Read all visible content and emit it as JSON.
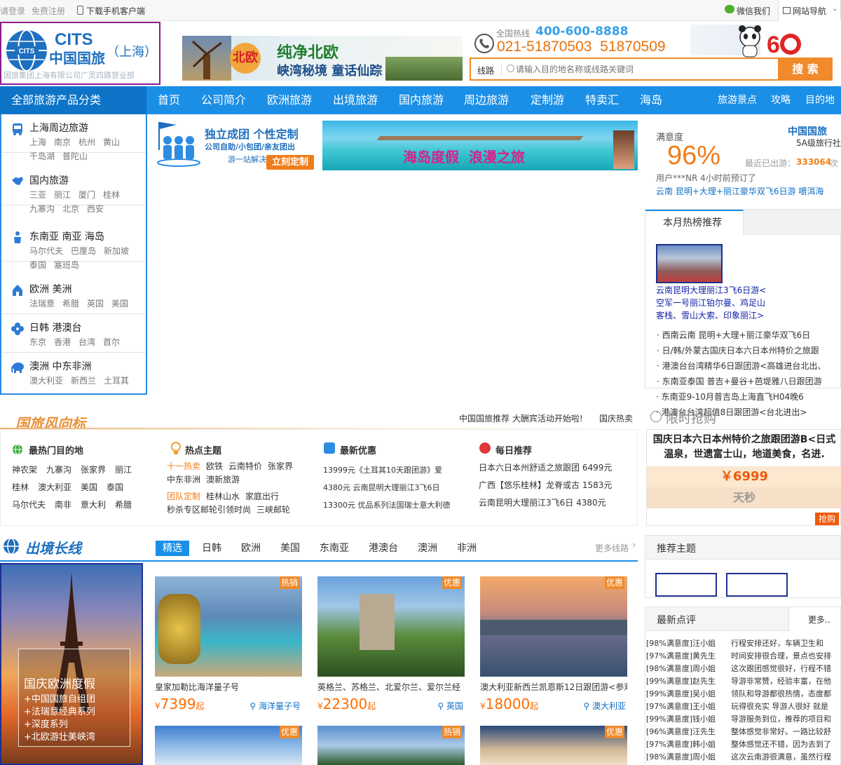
{
  "topbar": {
    "login": "请登录",
    "register": "免费注册",
    "mobile": "下载手机客户端",
    "wechat": "微信我们",
    "sitenav": "网站导航"
  },
  "logo": {
    "brand": "CITS",
    "cn": "中国国旅",
    "city": "（上海）",
    "sub": "国旅集团上海有限公司广灵四路营业部"
  },
  "banner": {
    "tag": "北欧",
    "title": "纯净北欧",
    "sub": "峡湾秘境 童话仙踪"
  },
  "hotline": {
    "label": "全国热线",
    "number": "400-600-8888",
    "local": "021-51870503  51870509"
  },
  "search": {
    "type": "线路",
    "placeholder": "请输入目的地名称或线路关键词",
    "button": "搜 索"
  },
  "nav": {
    "all": "全部旅游产品分类",
    "items": [
      "首页",
      "公司简介",
      "欧洲旅游",
      "出境旅游",
      "国内旅游",
      "周边旅游",
      "定制游",
      "特卖汇",
      "海岛"
    ],
    "right": [
      "旅游景点",
      "攻略",
      "目的地"
    ]
  },
  "sidebar": [
    {
      "title": "上海周边旅游",
      "links": [
        "上海",
        "南京",
        "杭州",
        "黄山",
        "千岛湖",
        "普陀山"
      ]
    },
    {
      "title": "国内旅游",
      "links": [
        "三亚",
        "丽江",
        "厦门",
        "桂林",
        "九寨沟",
        "北京",
        "西安"
      ]
    },
    {
      "title": "东南亚 南亚 海岛",
      "links": [
        "马尔代夫",
        "巴厘岛",
        "新加坡",
        "泰国",
        "塞班岛"
      ]
    },
    {
      "title": "欧洲 美洲",
      "links": [
        "法瑞意",
        "希腊",
        "英国",
        "美国"
      ]
    },
    {
      "title": "日韩 港澳台",
      "links": [
        "东京",
        "香港",
        "台湾",
        "首尔"
      ]
    },
    {
      "title": "澳洲 中东非洲",
      "links": [
        "澳大利亚",
        "新西兰",
        "土耳其"
      ]
    }
  ],
  "promo": {
    "t1": "独立成团 个性定制",
    "t2": "公司自助/小包团/亲友团出",
    "t3": "游一站解决",
    "btn": "立刻定制",
    "sea": "海岛度假  浪漫之旅"
  },
  "satisfaction": {
    "label": "满意度",
    "value": "96%",
    "brand": "中国国旅",
    "level": "5A级旅行社",
    "count_label": "最近已出游：",
    "count": "333064",
    "count_unit": "次",
    "user": "用户***NR  4小时前预订了",
    "trip": "云南  昆明+大理+丽江豪华双飞6日游  嚼洱海"
  },
  "hot": {
    "tab": "本月热榜推荐",
    "feat1": "云南昆明大理丽江3飞6日游<",
    "feat2": "空军一号丽江铂尔曼、鸡足山",
    "feat3": "客栈、雪山大索、印象丽江>",
    "items": [
      "西南云南  昆明+大理+丽江豪华双飞6日",
      "日/韩/外蒙古国庆日本六日本州特价之旅跟",
      "港澳台台湾精华6日跟团游<高雄进台北出、",
      "东南亚泰国  普吉+曼谷+芭堤雅八日跟团游",
      "东南亚9-10月普吉岛上海直飞H04晚6",
      "港澳台台湾超值8日跟团游<台北进出>"
    ]
  },
  "fengxiang": {
    "title": "国旅风向标",
    "n1": "中国国旅推荐 大酬宾活动开始啦!",
    "n2": "国庆热卖",
    "c1": {
      "title": "最热门目的地",
      "links": [
        "神农架",
        "九寨沟",
        "张家界",
        "丽江",
        "桂林",
        "澳大利亚",
        "美国",
        "泰国",
        "马尔代夫",
        "南非",
        "意大利",
        "希腊"
      ]
    },
    "c2": {
      "title": "热点主题",
      "l1": "十一热卖",
      "links1": [
        "欧铁",
        "云南特价",
        "张家界",
        "中东非洲",
        "澳新旅游"
      ],
      "l2": "团队定制",
      "links2": [
        "桂林山水",
        "家庭出行",
        "秒杀专区",
        "邮轮引领时尚",
        "三峡邮轮"
      ]
    },
    "c3": {
      "title": "最新优惠",
      "items": [
        "13999元《土耳其10天跟团游》爱",
        "4380元  云南昆明大理丽江3飞6日",
        "13300元  优品系列法国瑞士意大利德"
      ]
    },
    "c4": {
      "title": "每日推荐",
      "items": [
        "日本六日本州舒适之旅跟团  6499元",
        "广西【悠乐桂林】龙脊或古  1583元",
        "云南昆明大理丽江3飞6日  4380元"
      ]
    }
  },
  "flash": {
    "title": "限时抢购",
    "name": "国庆日本六日本州特价之旅跟团游B<日式温泉，世遗富士山，地道美食，名进.",
    "price": "￥6999",
    "countdown": "天秒",
    "buy": "抢购"
  },
  "chujing": {
    "title": "出境长线",
    "tabs": [
      "精选",
      "日韩",
      "欧洲",
      "美国",
      "东南亚",
      "港澳台",
      "澳洲",
      "非洲"
    ],
    "more": "更多线路",
    "poster": {
      "title": "国庆欧洲度假",
      "lines": [
        "+中国国旅自组团",
        "+法瑞意经典系列",
        "+深度系列",
        "+北欧游壮美峡湾"
      ]
    },
    "products": [
      {
        "tag": "热销",
        "name": "皇家加勒比海洋量子号",
        "price": "7399",
        "loc": "海洋量子号"
      },
      {
        "tag": "优惠",
        "name": "英格兰、苏格兰、北爱尔兰、爱尔兰经",
        "price": "22300",
        "loc": "英国"
      },
      {
        "tag": "优惠",
        "name": "澳大利亚新西兰凯恩斯12日跟团游<参观",
        "price": "18000",
        "loc": "澳大利亚"
      },
      {
        "tag": "优惠"
      },
      {
        "tag": "热销"
      },
      {
        "tag": "优惠"
      }
    ],
    "price_unit": "起",
    "currency": "¥"
  },
  "theme": {
    "title": "推荐主题"
  },
  "reviews": {
    "title": "最新点评",
    "more": "更多..",
    "items": [
      [
        "[98%满意度]汪小姐",
        "行程安排还好，车辆卫生和"
      ],
      [
        "[97%满意度]黄先生",
        "时间安排很合理，景点也安排"
      ],
      [
        "[98%满意度]周小姐",
        "这次跟团感觉很好，行程不错"
      ],
      [
        "[99%满意度]赵先生",
        "导游非常赞，经验丰富，在他"
      ],
      [
        "[99%满意度]吴小姐",
        "领队和导游都很热情，态度都"
      ],
      [
        "[97%满意度]王小姐",
        "玩得很充实 导游人很好 就是"
      ],
      [
        "[99%满意度]钱小姐",
        "导游服务到位，推荐的项目和"
      ],
      [
        "[96%满意度]汪先生",
        "整体感觉非常好。一路比较舒"
      ],
      [
        "[97%满意度]韩小姐",
        "整体感觉还不错，因为去到了"
      ],
      [
        "[98%满意度]周小姐",
        "这次云南游很满意，虽然行程"
      ]
    ]
  }
}
